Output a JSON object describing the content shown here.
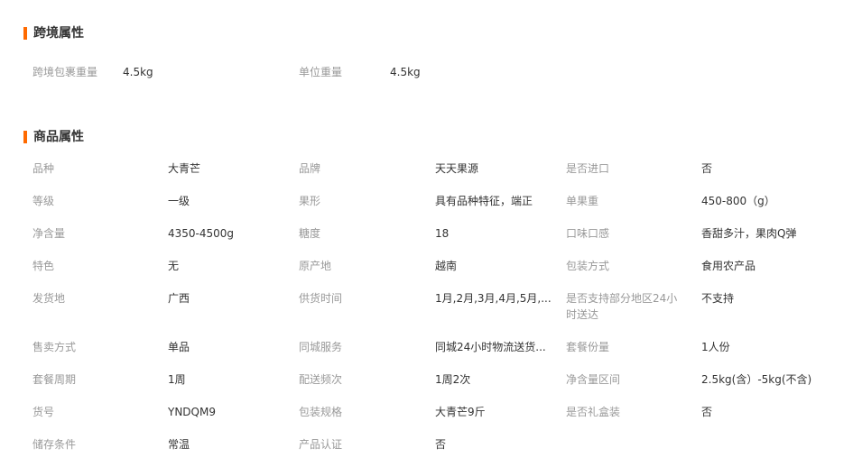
{
  "cross_border": {
    "title": "跨境属性",
    "items": [
      {
        "label": "跨境包裹重量",
        "value": "4.5kg"
      },
      {
        "label": "单位重量",
        "value": "4.5kg"
      }
    ]
  },
  "product": {
    "title": "商品属性",
    "rows": [
      [
        {
          "label": "品种",
          "value": "大青芒"
        },
        {
          "label": "品牌",
          "value": "天天果源"
        },
        {
          "label": "是否进口",
          "value": "否"
        }
      ],
      [
        {
          "label": "等级",
          "value": "一级"
        },
        {
          "label": "果形",
          "value": "具有品种特征，端正"
        },
        {
          "label": "单果重",
          "value": "450-800（g）"
        }
      ],
      [
        {
          "label": "净含量",
          "value": "4350-4500g"
        },
        {
          "label": "糖度",
          "value": "18"
        },
        {
          "label": "口味口感",
          "value": "香甜多汁，果肉Q弹"
        }
      ],
      [
        {
          "label": "特色",
          "value": "无"
        },
        {
          "label": "原产地",
          "value": "越南"
        },
        {
          "label": "包装方式",
          "value": "食用农产品"
        }
      ],
      [
        {
          "label": "发货地",
          "value": "广西"
        },
        {
          "label": "供货时间",
          "value": "1月,2月,3月,4月,5月,..."
        },
        {
          "label": "是否支持部分地区24小时送达",
          "value": "不支持"
        }
      ],
      [
        {
          "label": "售卖方式",
          "value": "单品"
        },
        {
          "label": "同城服务",
          "value": "同城24小时物流送货..."
        },
        {
          "label": "套餐份量",
          "value": "1人份"
        }
      ],
      [
        {
          "label": "套餐周期",
          "value": "1周"
        },
        {
          "label": "配送频次",
          "value": "1周2次"
        },
        {
          "label": "净含量区间",
          "value": "2.5kg(含）-5kg(不含)"
        }
      ],
      [
        {
          "label": "货号",
          "value": "YNDQM9"
        },
        {
          "label": "包装规格",
          "value": "大青芒9斤"
        },
        {
          "label": "是否礼盒装",
          "value": "否"
        }
      ],
      [
        {
          "label": "储存条件",
          "value": "常温"
        },
        {
          "label": "产品认证",
          "value": "否"
        }
      ]
    ]
  },
  "colors": {
    "accent": "#ff6a00",
    "label": "#999999",
    "value": "#333333"
  }
}
